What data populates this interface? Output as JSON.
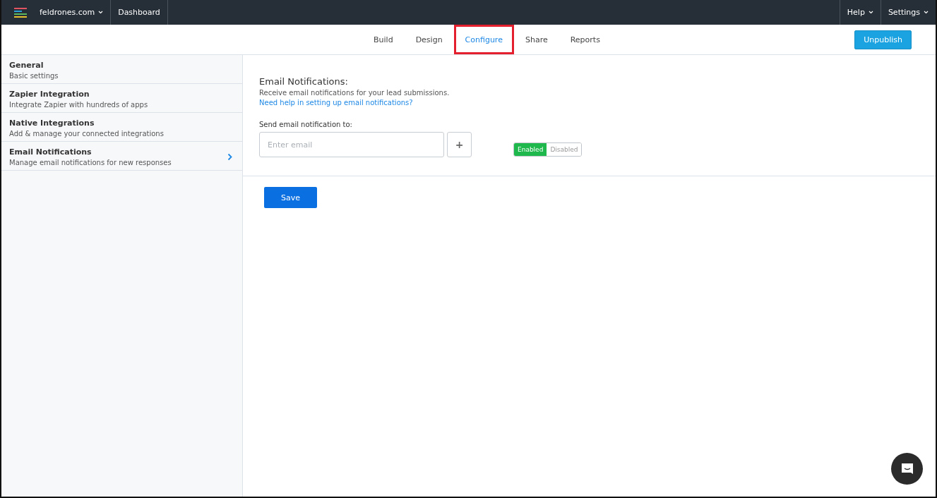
{
  "topbar": {
    "site": "feldrones.com",
    "links": [
      "Dashboard"
    ],
    "right_menus": [
      "Help",
      "Settings"
    ]
  },
  "tabs": [
    {
      "label": "Build",
      "selected": false,
      "highlighted": false
    },
    {
      "label": "Design",
      "selected": false,
      "highlighted": false
    },
    {
      "label": "Configure",
      "selected": true,
      "highlighted": true
    },
    {
      "label": "Share",
      "selected": false,
      "highlighted": false
    },
    {
      "label": "Reports",
      "selected": false,
      "highlighted": false
    }
  ],
  "publish_button": "Unpublish",
  "sidebar": {
    "items": [
      {
        "title": "General",
        "subtitle": "Basic settings",
        "selected": false
      },
      {
        "title": "Zapier Integration",
        "subtitle": "Integrate Zapier with hundreds of apps",
        "selected": false
      },
      {
        "title": "Native Integrations",
        "subtitle": "Add & manage your connected integrations",
        "selected": false
      },
      {
        "title": "Email Notifications",
        "subtitle": "Manage email notifications for new responses",
        "selected": true
      }
    ]
  },
  "section": {
    "title": "Email Notifications:",
    "description": "Receive email notifications for your lead submissions.",
    "help_link": "Need help in setting up email notifications?",
    "field_label": "Send email notification to:",
    "email": {
      "placeholder": "Enter email"
    },
    "add_button": "+",
    "toggle": [
      {
        "label": "Enabled",
        "selected": true
      },
      {
        "label": "Disabled",
        "selected": false
      }
    ]
  },
  "save_button": "Save"
}
